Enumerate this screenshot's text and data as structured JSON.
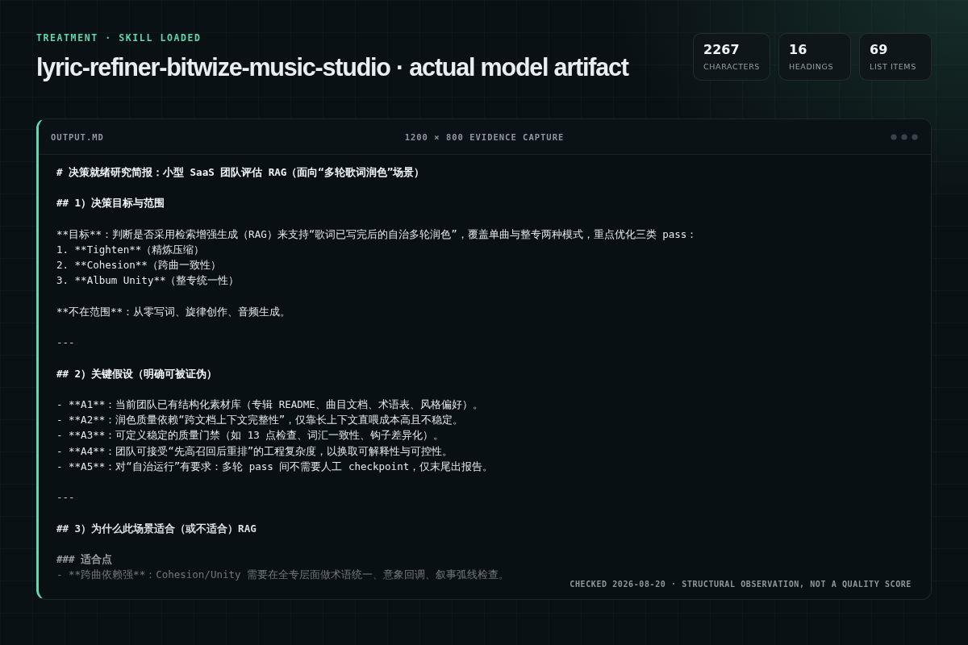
{
  "header": {
    "eyebrow": "TREATMENT · SKILL LOADED",
    "title": "lyric-refiner-bitwize-music-studio · actual model artifact"
  },
  "stats": [
    {
      "value": "2267",
      "label": "CHARACTERS"
    },
    {
      "value": "16",
      "label": "HEADINGS"
    },
    {
      "value": "69",
      "label": "LIST ITEMS"
    }
  ],
  "panel": {
    "file_name": "OUTPUT.MD",
    "caption": "1200 × 800 EVIDENCE CAPTURE",
    "blocks": [
      {
        "lines": [
          {
            "kind": "heading",
            "text": "# 决策就绪研究简报：小型 SaaS 团队评估 RAG（面向“多轮歌词润色”场景）"
          }
        ]
      },
      {
        "lines": [
          {
            "kind": "heading",
            "text": "## 1）决策目标与范围"
          }
        ]
      },
      {
        "lines": [
          {
            "kind": "text",
            "text": "**目标**：判断是否采用检索增强生成（RAG）来支持“歌词已写完后的自治多轮润色”，覆盖单曲与整专两种模式，重点优化三类 pass："
          },
          {
            "kind": "text",
            "text": "1. **Tighten**（精炼压缩）"
          },
          {
            "kind": "text",
            "text": "2. **Cohesion**（跨曲一致性）"
          },
          {
            "kind": "text",
            "text": "3. **Album Unity**（整专统一性）"
          }
        ]
      },
      {
        "lines": [
          {
            "kind": "text",
            "text": "**不在范围**：从零写词、旋律创作、音频生成。"
          }
        ]
      },
      {
        "lines": [
          {
            "kind": "rule",
            "text": "---"
          }
        ]
      },
      {
        "lines": [
          {
            "kind": "heading",
            "text": "## 2）关键假设（明确可被证伪）"
          }
        ]
      },
      {
        "lines": [
          {
            "kind": "text",
            "text": "- **A1**：当前团队已有结构化素材库（专辑 README、曲目文档、术语表、风格偏好）。"
          },
          {
            "kind": "text",
            "text": "- **A2**：润色质量依赖“跨文档上下文完整性”，仅靠长上下文直喂成本高且不稳定。"
          },
          {
            "kind": "text",
            "text": "- **A3**：可定义稳定的质量门禁（如 13 点检查、词汇一致性、钩子差异化）。"
          },
          {
            "kind": "text",
            "text": "- **A4**：团队可接受“先高召回后重排”的工程复杂度，以换取可解释性与可控性。"
          },
          {
            "kind": "text",
            "text": "- **A5**：对“自治运行”有要求：多轮 pass 间不需要人工 checkpoint，仅末尾出报告。"
          }
        ]
      },
      {
        "lines": [
          {
            "kind": "rule",
            "text": "---"
          }
        ]
      },
      {
        "lines": [
          {
            "kind": "heading",
            "text": "## 3）为什么此场景适合（或不适合）RAG"
          }
        ]
      },
      {
        "lines": [
          {
            "kind": "heading",
            "text": "### 适合点"
          },
          {
            "kind": "text",
            "text": "- **跨曲依赖强**：Cohesion/Unity 需要在全专层面做术语统一、意象回调、叙事弧线检查。"
          }
        ]
      }
    ],
    "footer": "CHECKED 2026-08-20 · STRUCTURAL OBSERVATION, NOT A QUALITY SCORE"
  }
}
